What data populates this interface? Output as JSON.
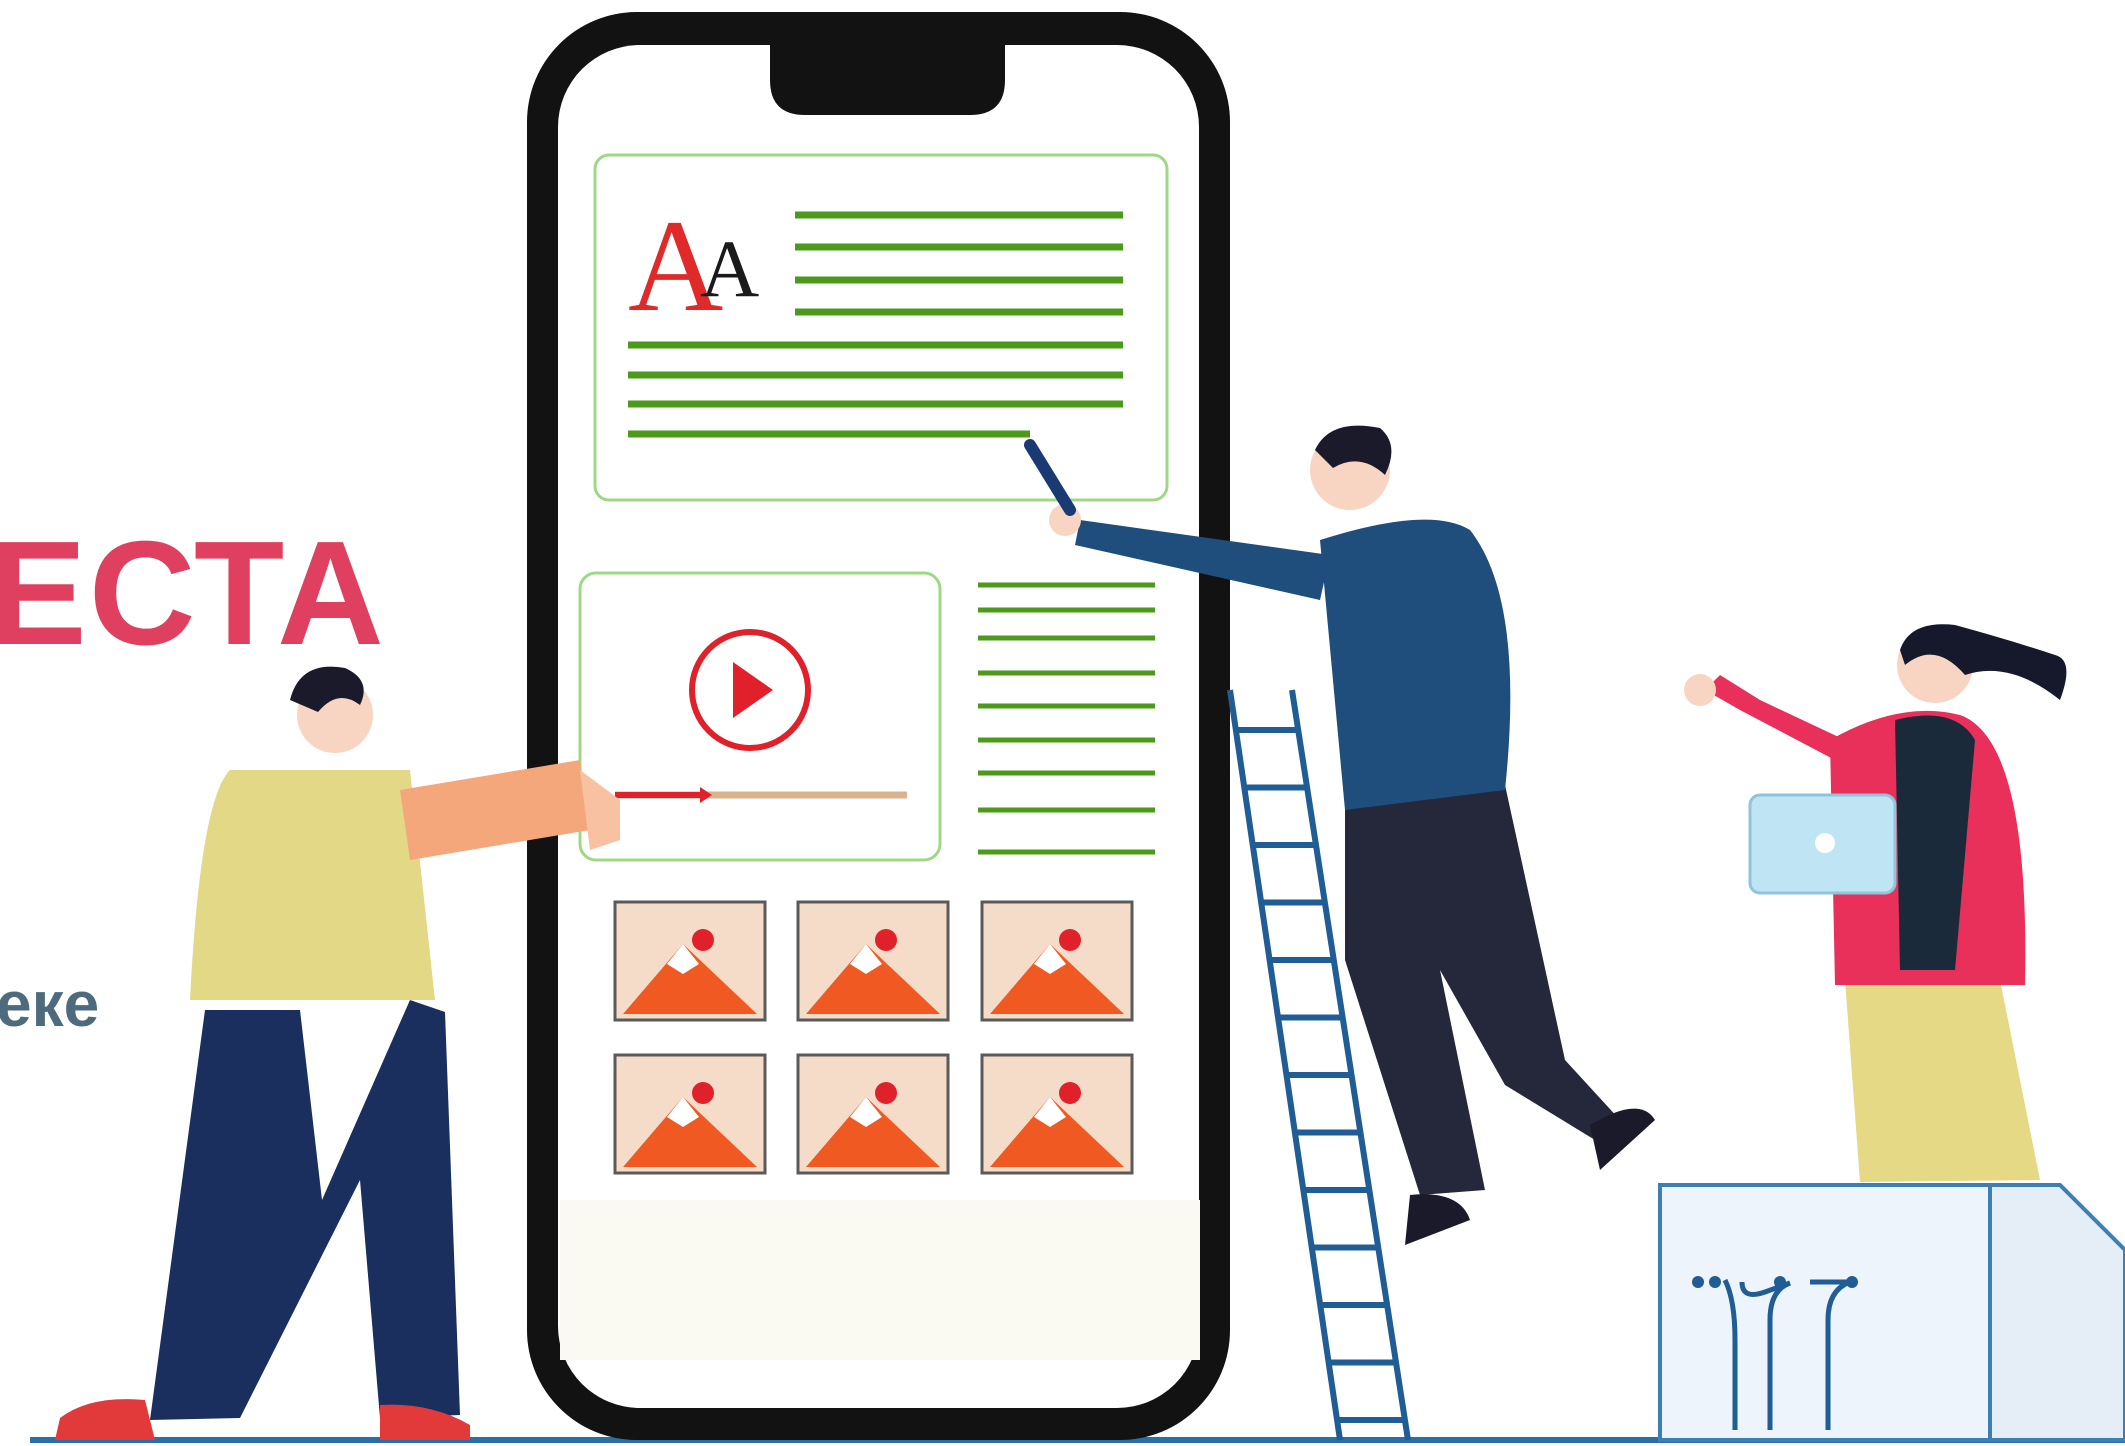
{
  "page": {
    "heading": "ЕСТА",
    "subheading": "еке"
  },
  "phone_screen": {
    "font_sample": {
      "big_letter": "A",
      "small_letter": "A"
    },
    "video_card": {
      "icon": "play-icon",
      "accent_color": "#e0202a"
    },
    "gallery": {
      "icon": "image-icon",
      "count": 6,
      "accent_color": "#f05a22"
    }
  },
  "palette": {
    "heading_color": "#e0405f",
    "subheading_color": "#4d6b7d",
    "text_line_color": "#4c9a1a",
    "phone_frame": "#121212"
  }
}
